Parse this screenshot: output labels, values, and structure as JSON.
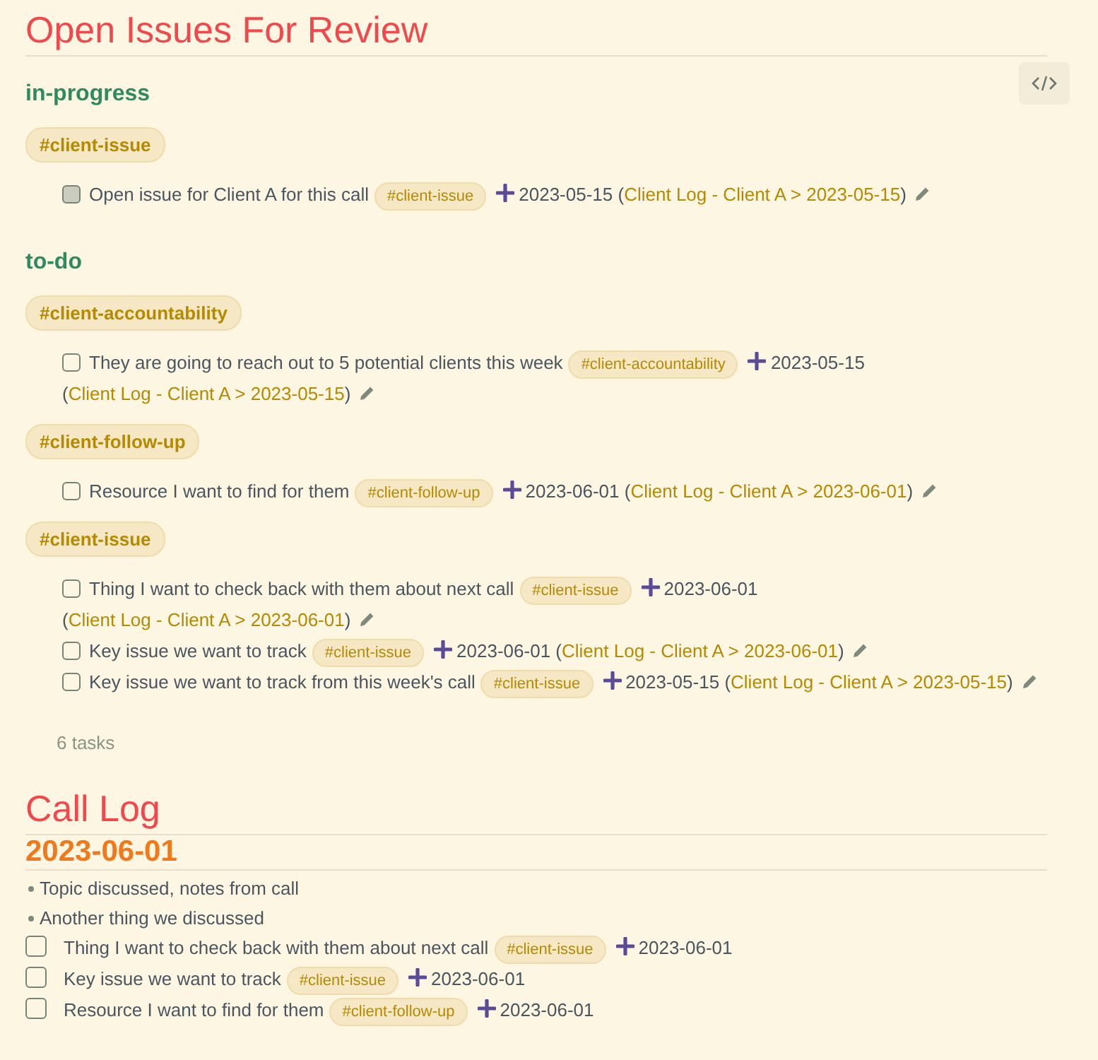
{
  "title": "Open Issues For Review",
  "groups": [
    {
      "status": "in-progress",
      "tags": [
        {
          "tag": "#client-issue",
          "tasks": [
            {
              "kind": "in_progress",
              "checked": false,
              "text": "Open issue for Client A for this call",
              "tag": "#client-issue",
              "date": "2023-05-15",
              "open": "(",
              "link": "Client Log - Client A > 2023-05-15",
              "close": ")"
            }
          ]
        }
      ]
    },
    {
      "status": "to-do",
      "tags": [
        {
          "tag": "#client-accountability",
          "tasks": [
            {
              "kind": "open",
              "checked": false,
              "text": "They are going to reach out to 5 potential clients this week",
              "tag": "#client-accountability",
              "date": "2023-05-15",
              "open": "(",
              "link": "Client Log - Client A > 2023-05-15",
              "close": ")"
            }
          ]
        },
        {
          "tag": "#client-follow-up",
          "tasks": [
            {
              "kind": "open",
              "checked": false,
              "text": "Resource I want to find for them",
              "tag": "#client-follow-up",
              "date": "2023-06-01",
              "open": "(",
              "link": "Client Log - Client A > 2023-06-01",
              "close": ")"
            }
          ]
        },
        {
          "tag": "#client-issue",
          "tasks": [
            {
              "kind": "open",
              "checked": false,
              "text": "Thing I want to check back with them about next call",
              "tag": "#client-issue",
              "date": "2023-06-01",
              "open": "(",
              "link": "Client Log - Client A > 2023-06-01",
              "close": ")"
            },
            {
              "kind": "open",
              "checked": false,
              "text": "Key issue we want to track",
              "tag": "#client-issue",
              "date": "2023-06-01",
              "open": "(",
              "link": "Client Log - Client A > 2023-06-01",
              "close": ")"
            },
            {
              "kind": "open",
              "checked": false,
              "text": "Key issue we want to track from this week's call",
              "tag": "#client-issue",
              "date": "2023-05-15",
              "open": "(",
              "link": "Client Log - Client A > 2023-05-15",
              "close": ")"
            }
          ]
        }
      ]
    }
  ],
  "task_count": "6 tasks",
  "call_log": {
    "title": "Call Log",
    "date": "2023-06-01",
    "notes": [
      "Topic discussed, notes from call",
      "Another thing we discussed"
    ],
    "tasks": [
      {
        "checked": false,
        "text": "Thing I want to check back with them about next call",
        "tag": "#client-issue",
        "date": "2023-06-01"
      },
      {
        "checked": false,
        "text": "Key issue we want to track",
        "tag": "#client-issue",
        "date": "2023-06-01"
      },
      {
        "checked": false,
        "text": "Resource I want to find for them",
        "tag": "#client-follow-up",
        "date": "2023-06-01"
      }
    ]
  }
}
